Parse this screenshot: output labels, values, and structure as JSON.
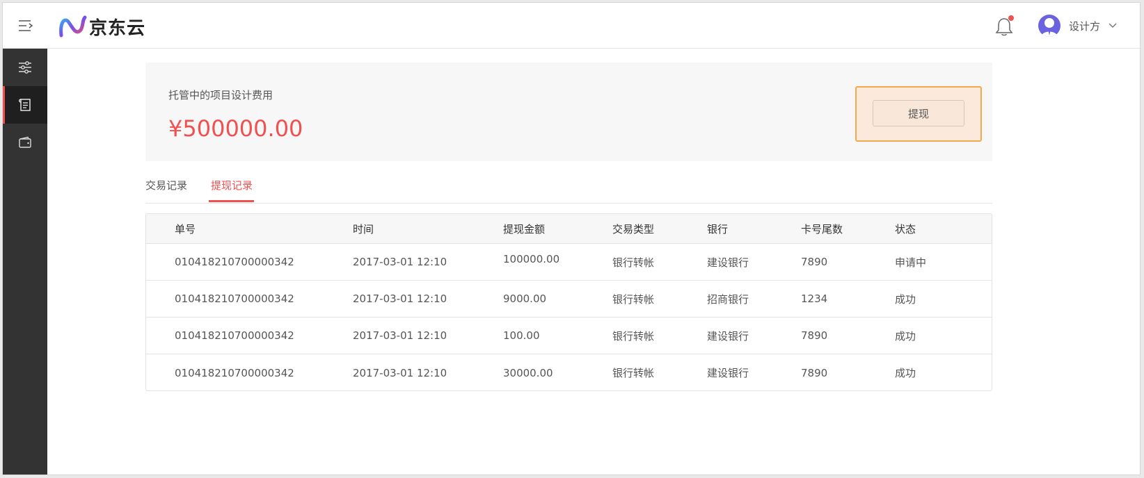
{
  "header": {
    "logo_text": "京东云",
    "user_name": "设计方"
  },
  "sidebar": {
    "items": [
      {
        "icon": "sliders-icon",
        "active": false
      },
      {
        "icon": "receipt-icon",
        "active": true
      },
      {
        "icon": "wallet-icon",
        "active": false
      }
    ]
  },
  "summary": {
    "label": "托管中的项目设计费用",
    "amount": "¥500000.00",
    "withdraw_label": "提现"
  },
  "tabs": [
    {
      "label": "交易记录",
      "active": false
    },
    {
      "label": "提现记录",
      "active": true
    }
  ],
  "table": {
    "columns": [
      "单号",
      "时间",
      "提现金额",
      "交易类型",
      "银行",
      "卡号尾数",
      "状态"
    ],
    "rows": [
      [
        "010418210700000342",
        "2017-03-01 12:10",
        "100000.00",
        "银行转帐",
        "建设银行",
        "7890",
        "申请中"
      ],
      [
        "010418210700000342",
        "2017-03-01 12:10",
        "9000.00",
        "银行转帐",
        "招商银行",
        "1234",
        "成功"
      ],
      [
        "010418210700000342",
        "2017-03-01 12:10",
        "100.00",
        "银行转帐",
        "建设银行",
        "7890",
        "成功"
      ],
      [
        "010418210700000342",
        "2017-03-01 12:10",
        "30000.00",
        "银行转帐",
        "建设银行",
        "7890",
        "成功"
      ]
    ]
  },
  "colors": {
    "accent": "#f0504f",
    "sidebar_bg": "#333333",
    "highlight_border": "#f6a94a",
    "highlight_bg": "#fbeadc"
  }
}
